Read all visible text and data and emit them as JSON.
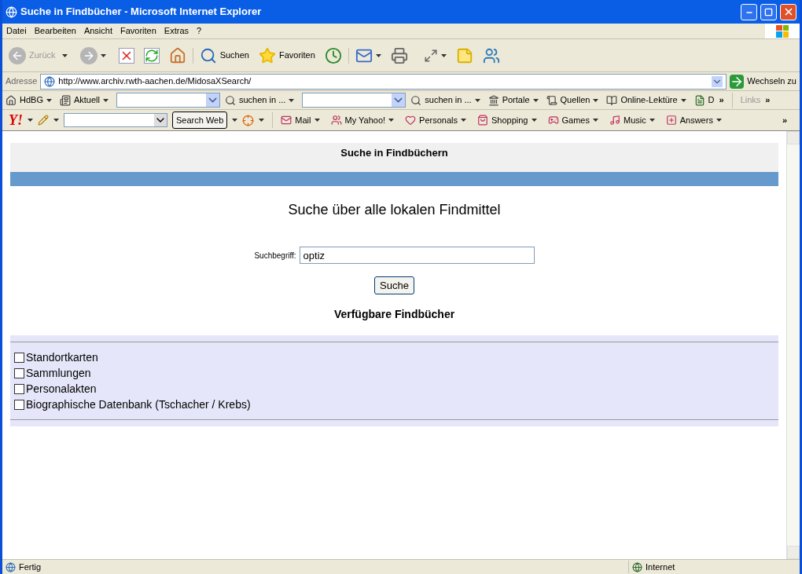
{
  "window": {
    "title": "Suche in Findbücher - Microsoft Internet Explorer"
  },
  "menu": [
    "Datei",
    "Bearbeiten",
    "Ansicht",
    "Favoriten",
    "Extras",
    "?"
  ],
  "toolbar": {
    "back": {
      "label": "Zurück",
      "disabled": true
    },
    "search": "Suchen",
    "favorites": "Favoriten"
  },
  "address": {
    "label": "Adresse",
    "url": "http://www.archiv.rwth-aachen.de/MidosaXSearch/",
    "go": "Wechseln zu"
  },
  "links_toolbar": {
    "items": [
      {
        "kind": "button",
        "label": "HdBG"
      },
      {
        "kind": "button",
        "label": "Aktuell"
      },
      {
        "kind": "combo"
      },
      {
        "kind": "button",
        "label": "suchen in ..."
      },
      {
        "kind": "combo"
      },
      {
        "kind": "button",
        "label": "suchen in ..."
      },
      {
        "kind": "button",
        "label": "Portale"
      },
      {
        "kind": "button",
        "label": "Quellen"
      },
      {
        "kind": "button",
        "label": "Online-Lektüre"
      },
      {
        "kind": "plain",
        "label": "D"
      }
    ],
    "more": "»",
    "links": "Links",
    "links_more": "»"
  },
  "yahoo_toolbar": {
    "logo": "Y!",
    "search_button": "Search Web",
    "items": [
      "Mail",
      "My Yahoo!",
      "Personals",
      "Shopping",
      "Games",
      "Music",
      "Answers"
    ],
    "more": "»"
  },
  "page": {
    "header": "Suche in Findbüchern",
    "subtitle": "Suche über alle lokalen Findmittel",
    "search_label": "Suchbegriff:",
    "search_value": "optiz",
    "search_button": "Suche",
    "section_title": "Verfügbare Findbücher",
    "findbuecher": [
      {
        "label": "Standortkarten",
        "checked": false
      },
      {
        "label": "Sammlungen",
        "checked": false
      },
      {
        "label": "Personalakten",
        "checked": false
      },
      {
        "label": "Biographische Datenbank (Tschacher / Krebs)",
        "checked": false
      }
    ]
  },
  "status_bar": {
    "text": "Fertig",
    "zone": "Internet"
  }
}
